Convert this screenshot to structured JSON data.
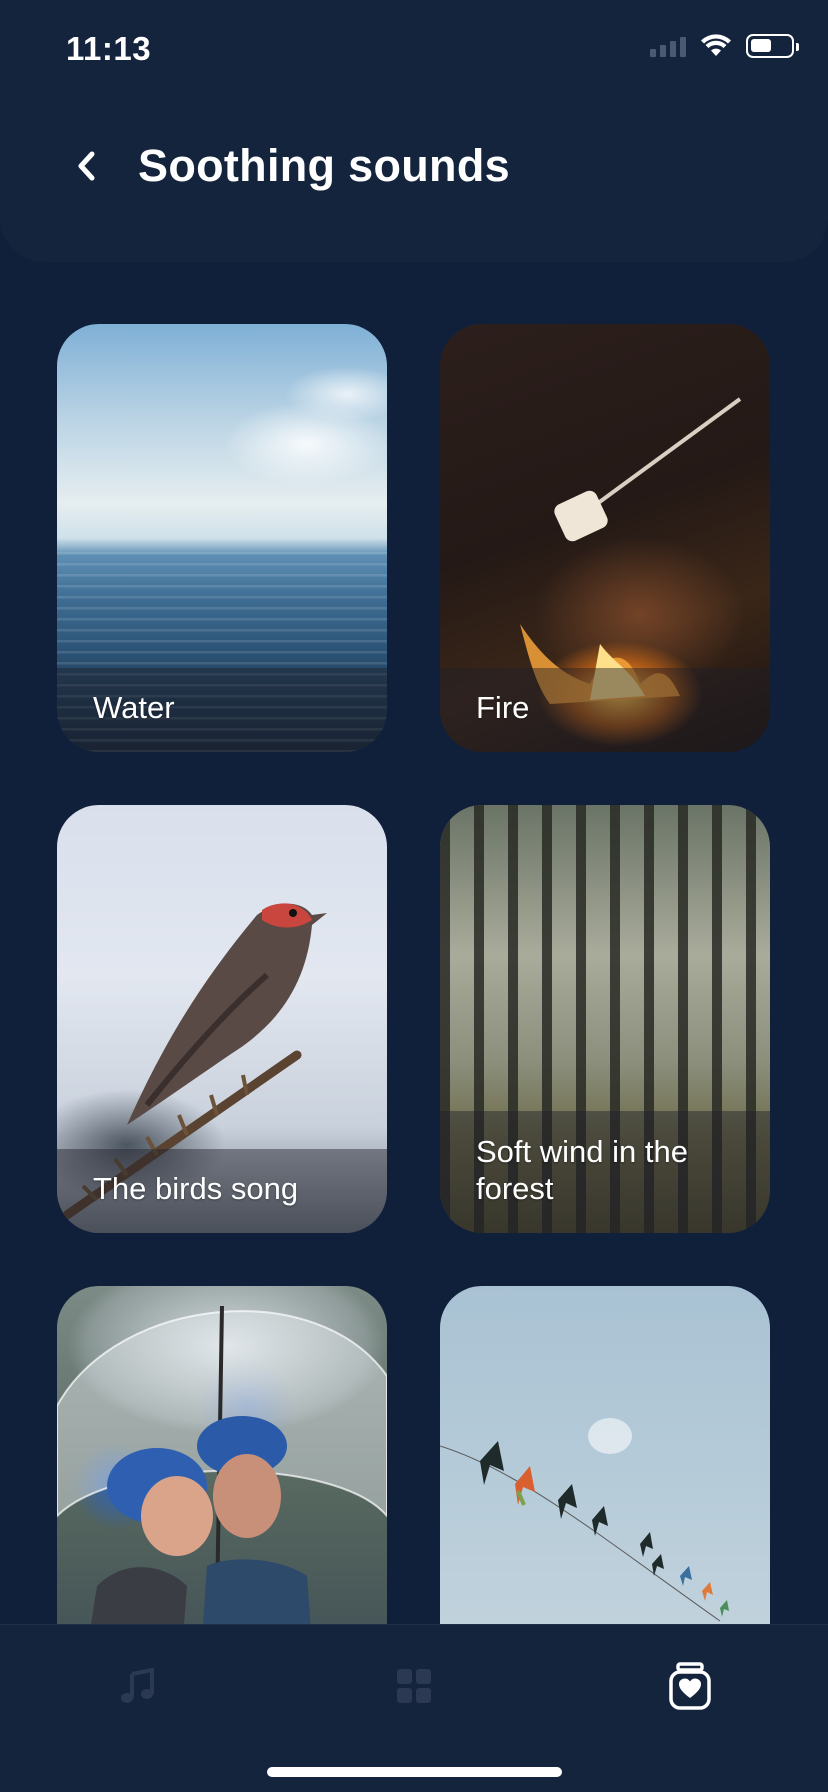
{
  "status_bar": {
    "time": "11:13",
    "icons": [
      "cellular-signal-icon",
      "wifi-icon",
      "battery-icon"
    ]
  },
  "header": {
    "back_icon": "chevron-left-icon",
    "title": "Soothing sounds"
  },
  "sounds": [
    {
      "label": "Water",
      "image": "ocean-horizon"
    },
    {
      "label": "Fire",
      "image": "campfire-marshmallow"
    },
    {
      "label": "The birds song",
      "image": "bird-on-branch"
    },
    {
      "label": "Soft wind in the forest",
      "image": "pine-forest"
    },
    {
      "label": "",
      "image": "couple-under-umbrella-rain"
    },
    {
      "label": "",
      "image": "kites-in-sky"
    }
  ],
  "bottom_nav": {
    "items": [
      {
        "icon": "music-note-icon",
        "active": false
      },
      {
        "icon": "grid-icon",
        "active": false
      },
      {
        "icon": "heart-jar-icon",
        "active": true
      }
    ]
  },
  "colors": {
    "background": "#11203a",
    "header": "#15243d",
    "nav_inactive": "#2b3a52",
    "nav_active": "#ffffff"
  }
}
